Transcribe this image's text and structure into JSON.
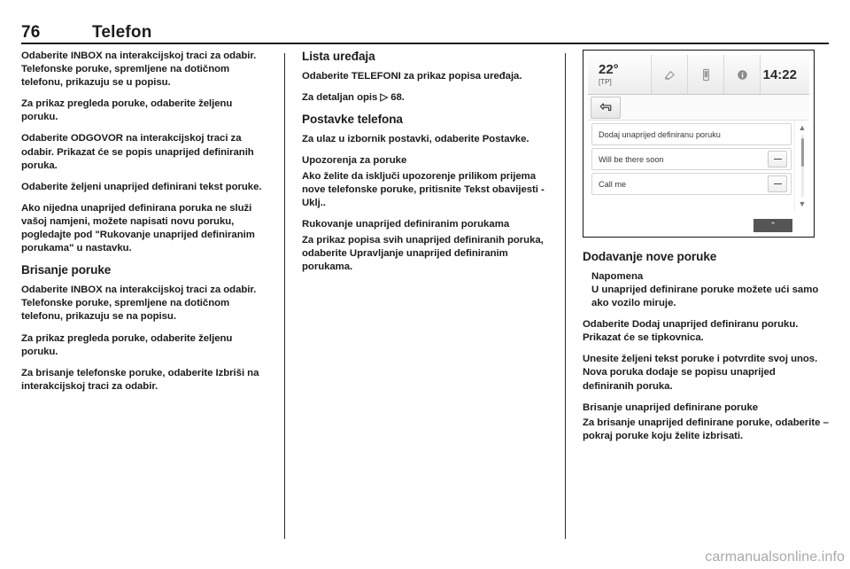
{
  "header": {
    "page_number": "76",
    "title": "Telefon"
  },
  "column1": {
    "p1": "Odaberite INBOX na interakcijskoj traci za odabir. Telefonske poruke, spremljene na dotičnom telefonu, prikazuju se u popisu.",
    "p2": "Za prikaz pregleda poruke, odaberite željenu poruku.",
    "p3": "Odaberite ODGOVOR na interakcijskoj traci za odabir. Prikazat će se popis unaprijed definiranih poruka.",
    "p4": "Odaberite željeni unaprijed definirani tekst poruke.",
    "p5": "Ako nijedna unaprijed definirana poruka ne služi vašoj namjeni, možete napisati novu poruku, pogledajte pod \"Rukovanje unaprijed definiranim porukama\" u nastavku.",
    "h_brisanje": "Brisanje poruke",
    "p6": "Odaberite INBOX na interakcijskoj traci za odabir. Telefonske poruke, spremljene na dotičnom telefonu, prikazuju se na popisu.",
    "p7": "Za prikaz pregleda poruke, odaberite željenu poruku.",
    "p8": "Za brisanje telefonske poruke, odaberite Izbriši na interakcijskoj traci za odabir."
  },
  "column2": {
    "h_lista": "Lista uređaja",
    "p1": "Odaberite TELEFONI za prikaz popisa uređaja.",
    "p2_prefix": "Za detaljan opis ",
    "p2_arrow": "▷",
    "p2_suffix": " 68.",
    "h_postavke": "Postavke telefona",
    "p3": "Za ulaz u izbornik postavki, odaberite Postavke.",
    "h_upozorenja": "Upozorenja za poruke",
    "p4": "Ako želite da isključi upozorenje prilikom prijema nove telefonske poruke, pritisnite Tekst obavijesti - Uklj..",
    "h_rukovanje": "Rukovanje unaprijed definiranim porukama",
    "p5": "Za prikaz popisa svih unaprijed definiranih poruka, odaberite Upravljanje unaprijed definiranim porukama."
  },
  "column3": {
    "screen": {
      "temperature": "22°",
      "traffic_program": "[TP]",
      "clock": "14:22",
      "back_icon": "back-arrow-icon",
      "status_icons": [
        "audio-source-icon",
        "phone-icon",
        "info-icon"
      ],
      "list_items": [
        {
          "label": "Dodaj unaprijed definiranu poruku",
          "has_remove": false
        },
        {
          "label": "Will be there soon",
          "has_remove": true
        },
        {
          "label": "Call me",
          "has_remove": true
        }
      ],
      "scroll_up_glyph": "▲",
      "scroll_down_glyph": "▼",
      "bottom_button_glyph": "⌃"
    },
    "h_dodavanje": "Dodavanje nove poruke",
    "note_title": "Napomena",
    "note_body": "U unaprijed definirane poruke možete ući samo ako vozilo miruje.",
    "p1": "Odaberite Dodaj unaprijed definiranu poruku. Prikazat će se tipkovnica.",
    "p2": "Unesite željeni tekst poruke i potvrdite svoj unos. Nova poruka dodaje se popisu unaprijed definiranih poruka.",
    "h_brisanje": "Brisanje unaprijed definirane poruke",
    "p3": "Za brisanje unaprijed definirane poruke, odaberite – pokraj poruke koju želite izbrisati."
  },
  "watermark": "carmanualsonline.info"
}
